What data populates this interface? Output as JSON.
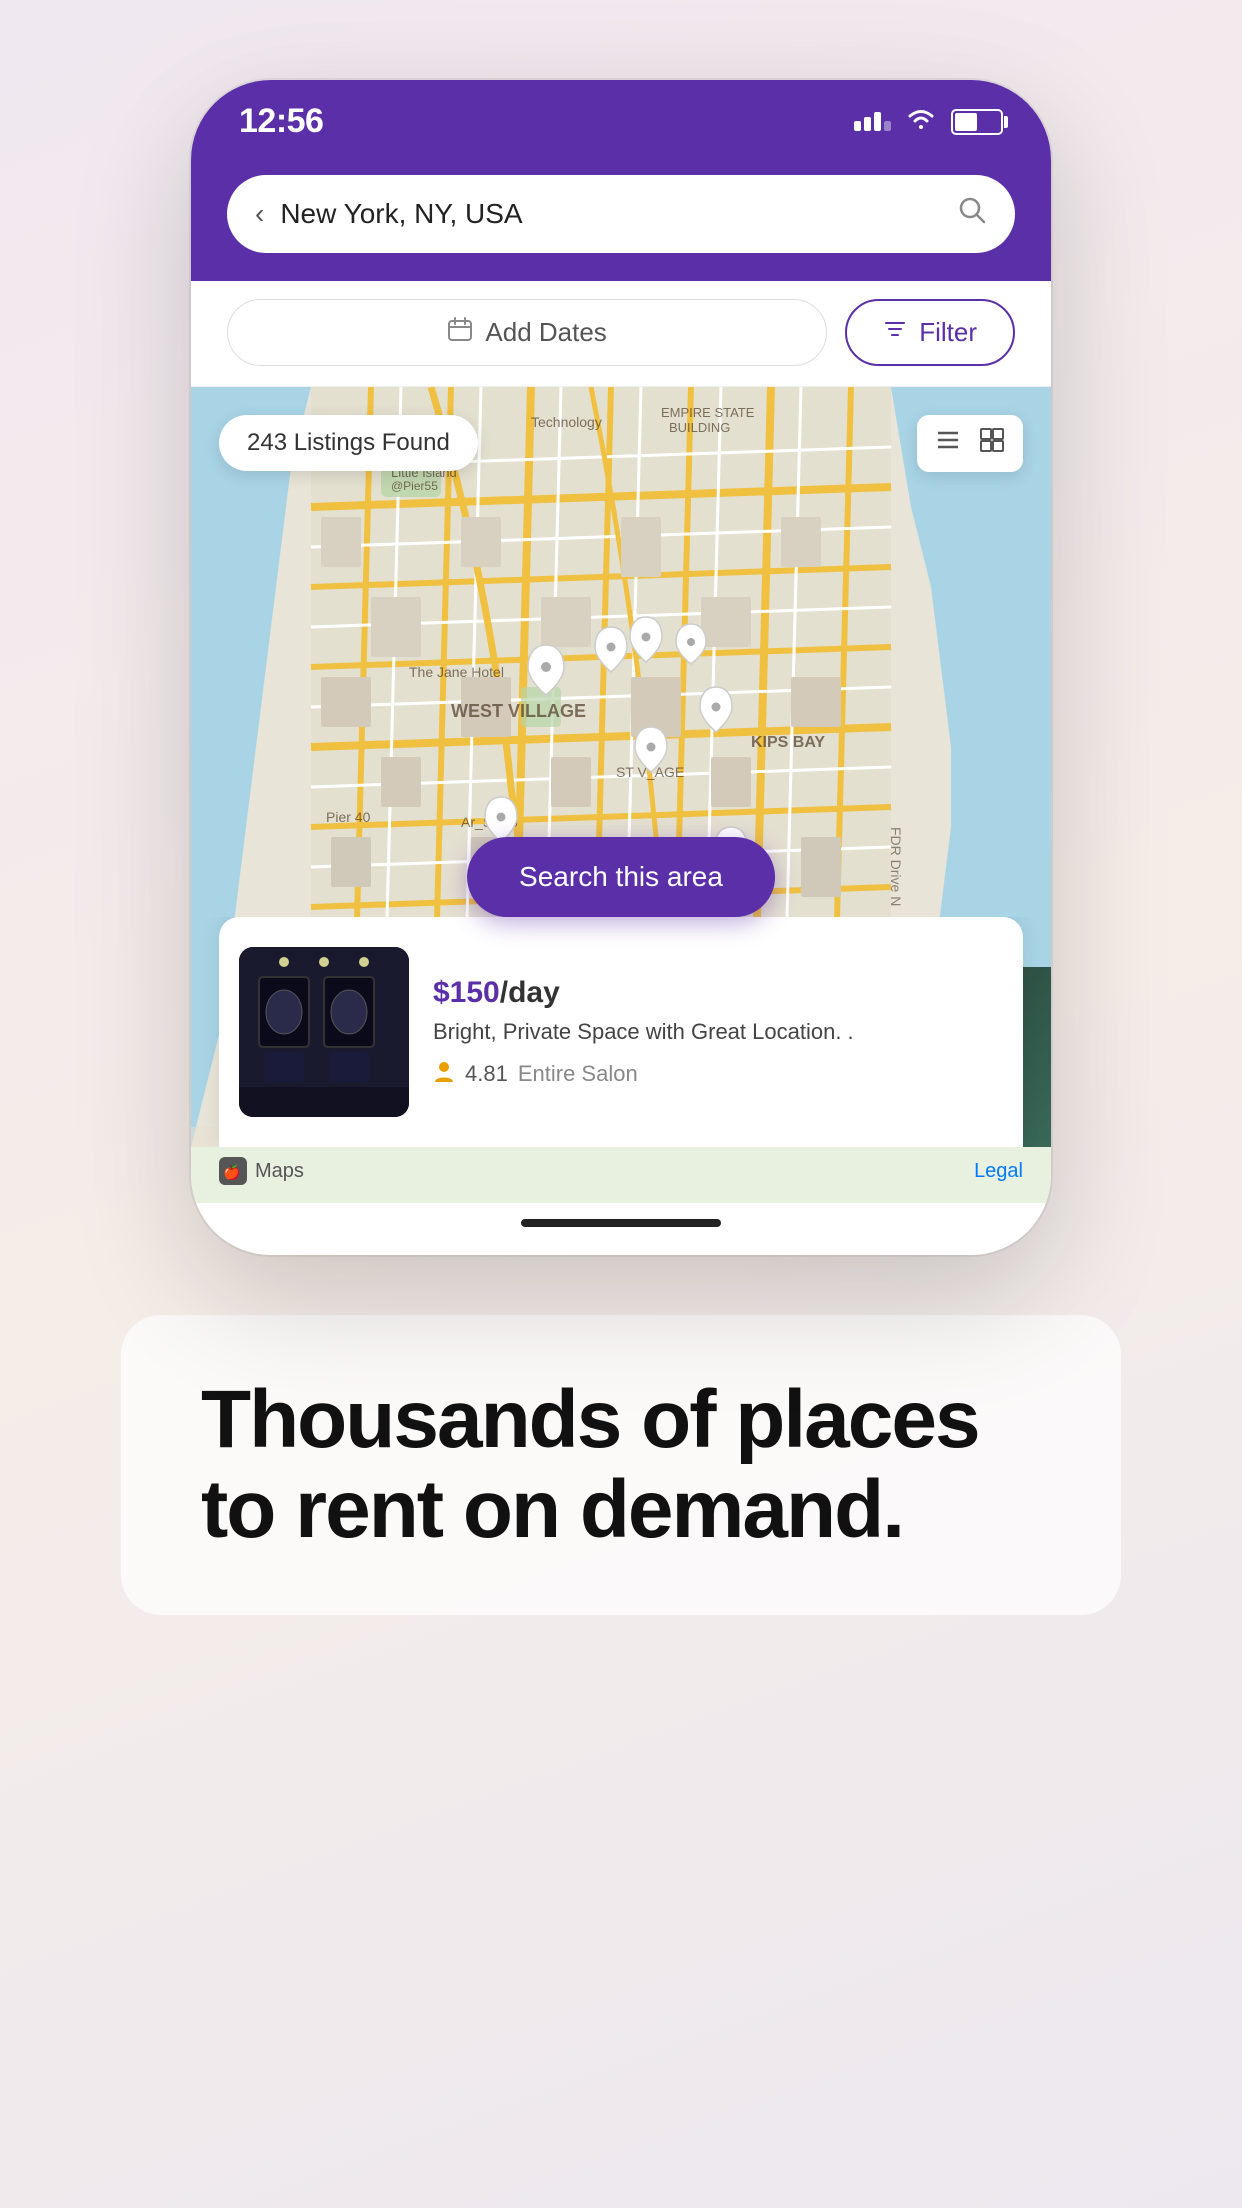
{
  "statusBar": {
    "time": "12:56",
    "locationIcon": "◂",
    "signalBars": [
      12,
      18,
      24
    ],
    "batteryLevel": 50
  },
  "searchBar": {
    "backArrow": "‹",
    "value": "New York, NY, USA",
    "searchIconLabel": "search-icon"
  },
  "filterBar": {
    "addDatesLabel": "Add Dates",
    "calendarIconLabel": "calendar-icon",
    "filterLabel": "Filter",
    "filterIconLabel": "filter-icon"
  },
  "map": {
    "listingsCount": "243 Listings Found",
    "listIconLabel": "list-icon",
    "gridIconLabel": "grid-icon",
    "searchAreaButton": "Search this area",
    "appleMapsBrand": "Maps",
    "legalText": "Legal"
  },
  "listingCard": {
    "price": "$150",
    "pricePeriod": "/day",
    "title": "Bright, Private Space with Great Location. .",
    "rating": "4.81",
    "type": "Entire Salon",
    "personIconLabel": "person-icon"
  },
  "bottomSection": {
    "tagline": "Thousands of places to rent on demand."
  }
}
